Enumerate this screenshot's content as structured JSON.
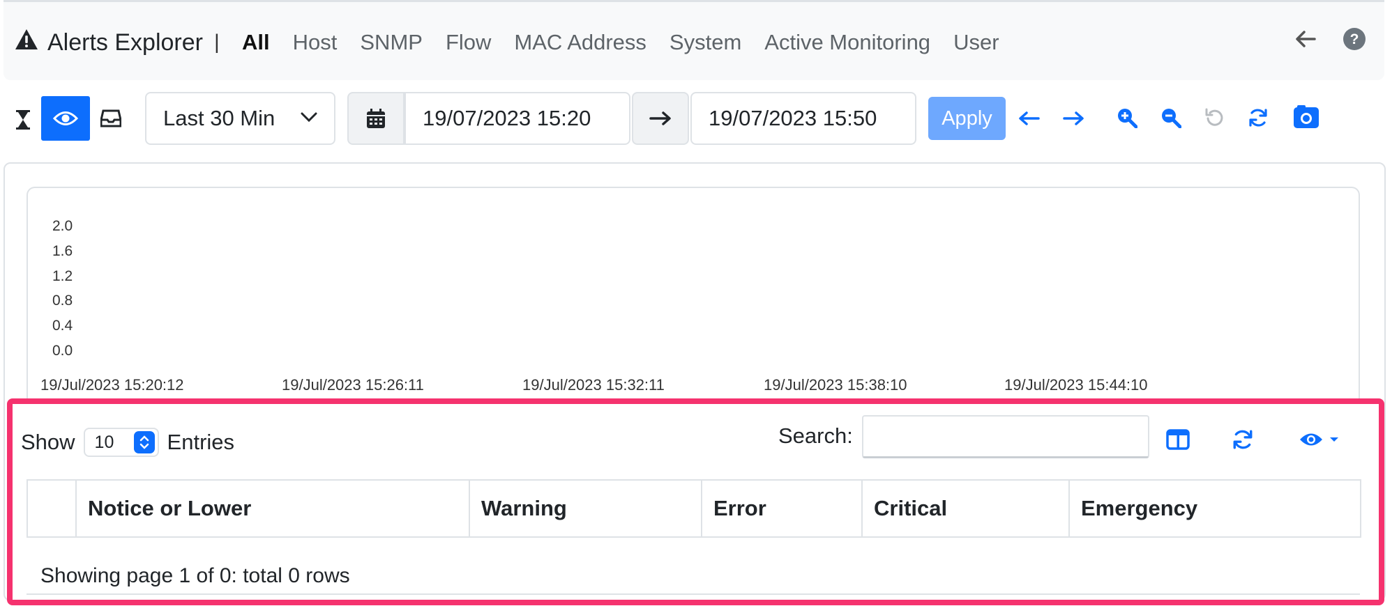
{
  "nav": {
    "title": "Alerts Explorer",
    "separator": "|",
    "links": [
      {
        "label": "All",
        "active": true
      },
      {
        "label": "Host"
      },
      {
        "label": "SNMP"
      },
      {
        "label": "Flow"
      },
      {
        "label": "MAC Address"
      },
      {
        "label": "System"
      },
      {
        "label": "Active Monitoring"
      },
      {
        "label": "User"
      }
    ],
    "icons": [
      "back-arrow-icon",
      "help-icon"
    ]
  },
  "toolbar": {
    "view_icons": [
      "hourglass-icon",
      "eye-icon",
      "inbox-icon"
    ],
    "range_select": "Last 30 Min",
    "begin_date": "19/07/2023 15:20",
    "end_date": "19/07/2023 15:50",
    "apply_label": "Apply",
    "accent_color": "#0d6efd",
    "apply_color": "#6ea8fe"
  },
  "chart_data": {
    "type": "bar",
    "ylim": [
      0,
      2.0
    ],
    "yticks": [
      "2.0",
      "1.6",
      "1.2",
      "0.8",
      "0.4",
      "0.0"
    ],
    "xticks": [
      "19/Jul/2023 15:20:12",
      "19/Jul/2023 15:26:11",
      "19/Jul/2023 15:32:11",
      "19/Jul/2023 15:38:10",
      "19/Jul/2023 15:44:10"
    ],
    "series": []
  },
  "table": {
    "show_label": "Show",
    "entries_value": "10",
    "entries_label": "Entries",
    "search_label": "Search:",
    "search_value": "",
    "columns": [
      "",
      "Notice or Lower",
      "Warning",
      "Error",
      "Critical",
      "Emergency"
    ],
    "rows": [],
    "footer": "Showing page 1 of 0: total 0 rows",
    "highlight_color": "#f5326e"
  }
}
